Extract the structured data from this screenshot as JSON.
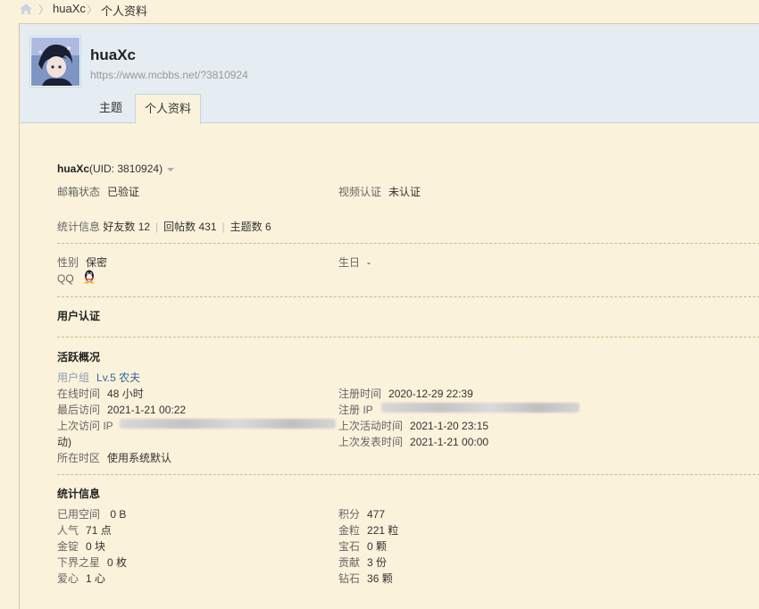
{
  "breadcrumb": {
    "items": [
      "huaXc",
      "个人资料"
    ],
    "separator": "〉"
  },
  "profile": {
    "username": "huaXc",
    "url": "https://www.mcbbs.net/?3810924",
    "tabs": [
      {
        "label": "主题",
        "active": false
      },
      {
        "label": "个人资料",
        "active": true
      }
    ]
  },
  "info": {
    "title_name": "huaXc",
    "title_uid": "(UID: 3810924)",
    "email_label": "邮箱状态",
    "email_value": "已验证",
    "video_label": "视频认证",
    "video_value": "未认证",
    "stats_label": "统计信息",
    "friends": "好友数 12",
    "posts": "回帖数 431",
    "threads": "主题数 6",
    "gender_label": "性别",
    "gender_value": "保密",
    "birthday_label": "生日",
    "birthday_value": "-",
    "qq_label": "QQ"
  },
  "sections": {
    "auth_title": "用户认证",
    "activity_title": "活跃概况",
    "stats_title": "统计信息"
  },
  "activity": {
    "group_label": "用户组",
    "group_value": "Lv.5 农夫",
    "online_label": "在线时间",
    "online_value": "48 小时",
    "register_label": "注册时间",
    "register_value": "2020-12-29 22:39",
    "last_visit_label": "最后访问",
    "last_visit_value": "2021-1-21 00:22",
    "register_ip_label": "注册 IP",
    "last_ip_label": "上次访问 IP",
    "last_ip_tail": "动)",
    "last_active_label": "上次活动时间",
    "last_active_value": "2021-1-20 23:15",
    "last_post_label": "上次发表时间",
    "last_post_value": "2021-1-21 00:00",
    "timezone_label": "所在时区",
    "timezone_value": "使用系统默认"
  },
  "stats": {
    "left": [
      {
        "label": "已用空间",
        "value": " 0 B"
      },
      {
        "label": "人气",
        "value": "71 点"
      },
      {
        "label": "金锭",
        "value": "0 块"
      },
      {
        "label": "下界之星",
        "value": "0 枚"
      },
      {
        "label": "爱心",
        "value": "1 心"
      }
    ],
    "right": [
      {
        "label": "积分",
        "value": "477"
      },
      {
        "label": "金粒",
        "value": "221 粒"
      },
      {
        "label": "宝石",
        "value": "0 颗"
      },
      {
        "label": "贡献",
        "value": "3 份"
      },
      {
        "label": "钻石",
        "value": "36 颗"
      }
    ]
  },
  "colors": {
    "page_bg": "#fbf2db",
    "header_bg": "#e5edf2",
    "link": "#336699"
  }
}
